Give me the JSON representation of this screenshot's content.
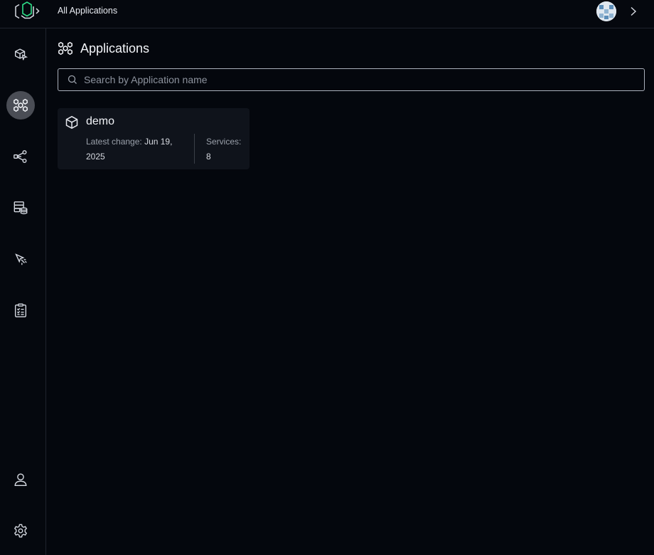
{
  "header": {
    "breadcrumb": "All Applications"
  },
  "sidebar": {
    "items": [
      {
        "icon": "deploy-box-icon",
        "active": false
      },
      {
        "icon": "applications-grid-icon",
        "active": true
      },
      {
        "icon": "share-nodes-icon",
        "active": false
      },
      {
        "icon": "database-stack-icon",
        "active": false
      },
      {
        "icon": "pointer-click-icon",
        "active": false
      },
      {
        "icon": "clipboard-checklist-icon",
        "active": false
      },
      {
        "icon": "user-icon",
        "active": false
      },
      {
        "icon": "gear-icon",
        "active": false
      }
    ]
  },
  "main": {
    "title": "Applications",
    "search": {
      "placeholder": "Search by Application name",
      "value": ""
    },
    "applications": [
      {
        "name": "demo",
        "latest_change_label": "Latest change:",
        "latest_change_value": "Jun 19, 2025",
        "services_label": "Services:",
        "services_value": "8"
      }
    ]
  },
  "colors": {
    "background": "#04070d",
    "accent": "#2ee08a",
    "active_nav": "#4a4d55"
  }
}
